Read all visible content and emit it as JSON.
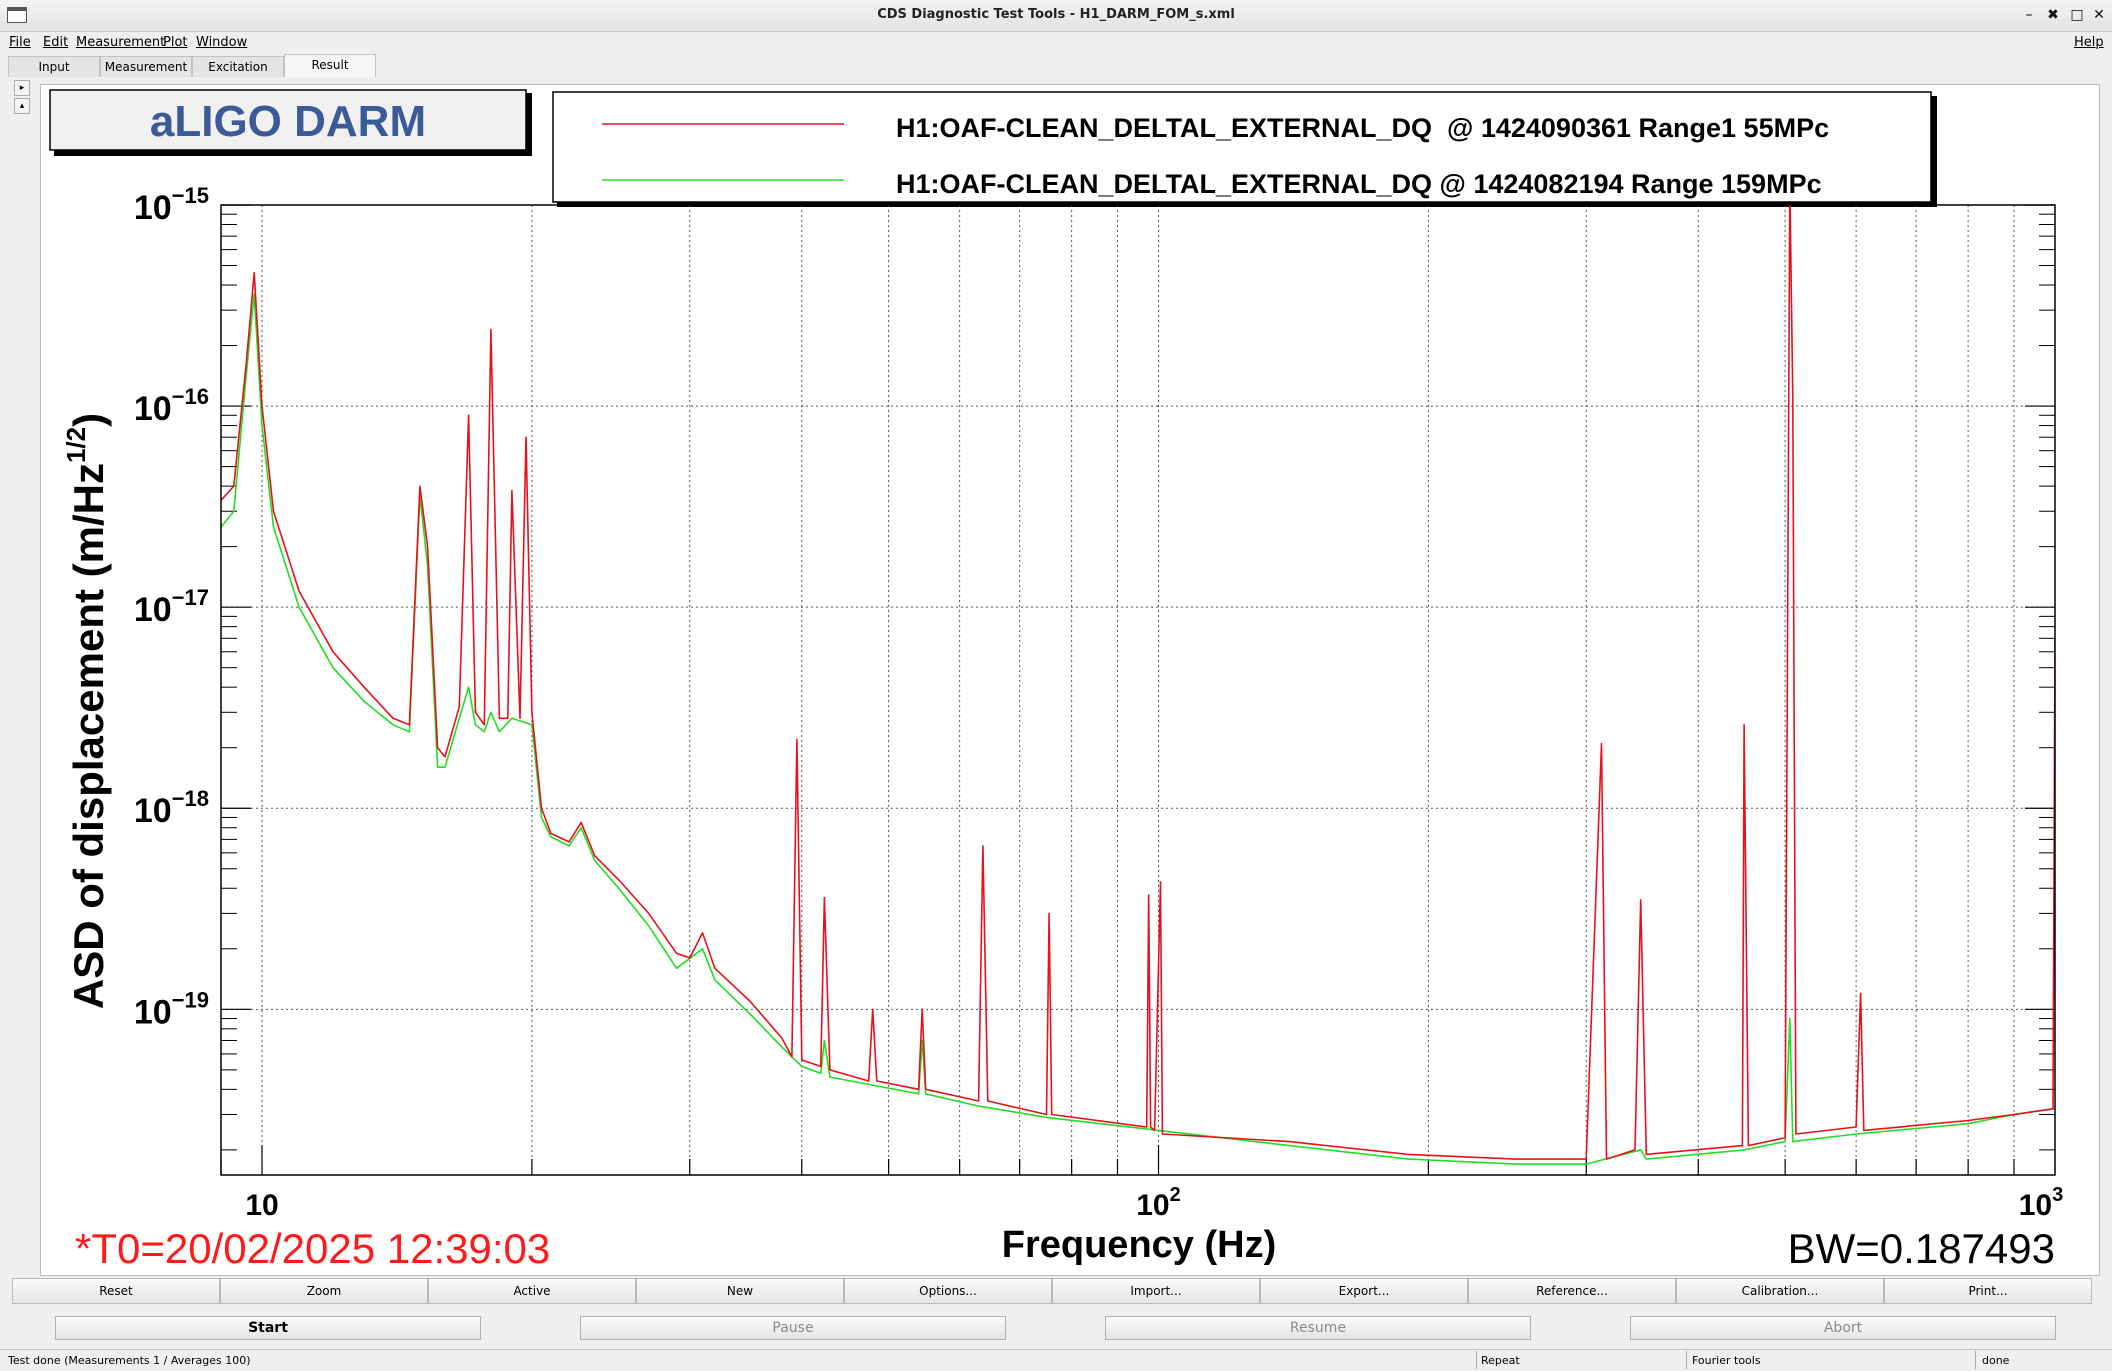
{
  "window": {
    "title": "CDS Diagnostic Test Tools - H1_DARM_FOM_s.xml",
    "controls": [
      "–",
      "✖",
      "□",
      "✕"
    ]
  },
  "menu": {
    "items": [
      "File",
      "Edit",
      "Measurement",
      "Plot",
      "Window"
    ],
    "help": "Help"
  },
  "tabs": [
    {
      "label": "Input"
    },
    {
      "label": "Measurement"
    },
    {
      "label": "Excitation"
    },
    {
      "label": "Result",
      "active": true
    }
  ],
  "plot": {
    "title_box": "aLIGO DARM",
    "t0_text": "*T0=20/02/2025 12:39:03",
    "bw_text": "BW=0.187493",
    "colors": {
      "red": "#e8101b",
      "green": "#22dd22",
      "title": "#3b5a98",
      "t0": "#ff1a1a"
    }
  },
  "chart_data": {
    "type": "line",
    "xlabel": "Frequency (Hz)",
    "ylabel": "ASD of displacement (m/Hz^{1/2})",
    "xscale": "log",
    "yscale": "log",
    "xlim": [
      9,
      1000
    ],
    "ylim": [
      1.5e-20,
      1e-15
    ],
    "grid": true,
    "legend_position": "top",
    "x_tick_labels": [
      {
        "value": 10,
        "base": "10",
        "exp": ""
      },
      {
        "value": 100,
        "base": "10",
        "exp": "2"
      },
      {
        "value": 1000,
        "base": "10",
        "exp": "3"
      }
    ],
    "y_tick_labels": [
      {
        "value": 1e-15,
        "base": "10",
        "exp": "−15"
      },
      {
        "value": 1e-16,
        "base": "10",
        "exp": "−16"
      },
      {
        "value": 1e-17,
        "base": "10",
        "exp": "−17"
      },
      {
        "value": 1e-18,
        "base": "10",
        "exp": "−18"
      },
      {
        "value": 1e-19,
        "base": "10",
        "exp": "−19"
      }
    ],
    "series": [
      {
        "name": "H1:OAF-CLEAN_DELTAL_EXTERNAL_DQ  @ 1424090361 Range1 55MPc",
        "color": "#e8101b",
        "points": [
          [
            9,
            3.4e-17
          ],
          [
            9.3,
            4e-17
          ],
          [
            9.6,
            1.6e-16
          ],
          [
            9.8,
            4.6e-16
          ],
          [
            10.0,
            1e-16
          ],
          [
            10.3,
            3e-17
          ],
          [
            11,
            1.2e-17
          ],
          [
            12,
            6e-18
          ],
          [
            13,
            4e-18
          ],
          [
            14,
            2.8e-18
          ],
          [
            14.6,
            2.6e-18
          ],
          [
            15,
            4e-17
          ],
          [
            15.3,
            2e-17
          ],
          [
            15.7,
            2e-18
          ],
          [
            16,
            1.8e-18
          ],
          [
            16.6,
            3.2e-18
          ],
          [
            17,
            9e-17
          ],
          [
            17.3,
            3e-18
          ],
          [
            17.7,
            2.6e-18
          ],
          [
            18,
            2.4e-16
          ],
          [
            18.4,
            2.8e-18
          ],
          [
            18.8,
            2.8e-18
          ],
          [
            19.0,
            3.8e-17
          ],
          [
            19.4,
            2.8e-18
          ],
          [
            19.7,
            7e-17
          ],
          [
            20,
            3e-18
          ],
          [
            20.5,
            1e-18
          ],
          [
            21,
            7.5e-19
          ],
          [
            22,
            6.8e-19
          ],
          [
            22.7,
            8.5e-19
          ],
          [
            23.5,
            5.8e-19
          ],
          [
            25,
            4.4e-19
          ],
          [
            27,
            3e-19
          ],
          [
            29,
            1.9e-19
          ],
          [
            30,
            1.8e-19
          ],
          [
            31,
            2.4e-19
          ],
          [
            32,
            1.6e-19
          ],
          [
            35,
            1.1e-19
          ],
          [
            38,
            7.2e-20
          ],
          [
            39,
            5.8e-20
          ],
          [
            39.5,
            2.2e-18
          ],
          [
            40,
            5.6e-20
          ],
          [
            42,
            5.2e-20
          ],
          [
            42.4,
            3.6e-19
          ],
          [
            43,
            5e-20
          ],
          [
            47.5,
            4.4e-20
          ],
          [
            48,
            1e-19
          ],
          [
            48.5,
            4.4e-20
          ],
          [
            54,
            4e-20
          ],
          [
            54.5,
            1e-19
          ],
          [
            55,
            4e-20
          ],
          [
            63,
            3.5e-20
          ],
          [
            63.7,
            6.5e-19
          ],
          [
            64.5,
            3.5e-20
          ],
          [
            75,
            3e-20
          ],
          [
            75.5,
            3e-19
          ],
          [
            76,
            3e-20
          ],
          [
            97,
            2.6e-20
          ],
          [
            97.5,
            3.7e-19
          ],
          [
            98,
            2.6e-20
          ],
          [
            99,
            2.5e-20
          ],
          [
            100.5,
            4.3e-19
          ],
          [
            101,
            2.4e-20
          ],
          [
            140,
            2.2e-20
          ],
          [
            190,
            1.9e-20
          ],
          [
            250,
            1.8e-20
          ],
          [
            300,
            1.8e-20
          ],
          [
            312,
            2.1e-18
          ],
          [
            316,
            1.8e-20
          ],
          [
            340,
            2e-20
          ],
          [
            345,
            3.5e-19
          ],
          [
            350,
            1.9e-20
          ],
          [
            448,
            2.1e-20
          ],
          [
            450,
            2.6e-18
          ],
          [
            455,
            2.1e-20
          ],
          [
            500,
            2.3e-20
          ],
          [
            506,
            1.3e-15
          ],
          [
            510,
            1.1e-16
          ],
          [
            514,
            2.4e-20
          ],
          [
            600,
            2.6e-20
          ],
          [
            607,
            1.2e-19
          ],
          [
            612,
            2.5e-20
          ],
          [
            800,
            2.8e-20
          ],
          [
            900,
            3e-20
          ],
          [
            995,
            3.2e-20
          ],
          [
            1000,
            7e-18
          ]
        ]
      },
      {
        "name": "H1:OAF-CLEAN_DELTAL_EXTERNAL_DQ @ 1424082194 Range 159MPc",
        "color": "#22dd22",
        "points": [
          [
            9,
            2.5e-17
          ],
          [
            9.3,
            3e-17
          ],
          [
            9.6,
            1.4e-16
          ],
          [
            9.8,
            3.6e-16
          ],
          [
            10.0,
            8e-17
          ],
          [
            10.3,
            2.5e-17
          ],
          [
            11,
            1e-17
          ],
          [
            12,
            5e-18
          ],
          [
            13,
            3.4e-18
          ],
          [
            14,
            2.6e-18
          ],
          [
            14.6,
            2.4e-18
          ],
          [
            15,
            3.6e-17
          ],
          [
            15.3,
            1.6e-17
          ],
          [
            15.7,
            1.6e-18
          ],
          [
            16,
            1.6e-18
          ],
          [
            16.6,
            2.8e-18
          ],
          [
            17,
            4e-18
          ],
          [
            17.3,
            2.6e-18
          ],
          [
            17.7,
            2.4e-18
          ],
          [
            18,
            3e-18
          ],
          [
            18.4,
            2.4e-18
          ],
          [
            19,
            2.8e-18
          ],
          [
            20,
            2.6e-18
          ],
          [
            20.5,
            9e-19
          ],
          [
            21,
            7.2e-19
          ],
          [
            22,
            6.5e-19
          ],
          [
            22.7,
            8e-19
          ],
          [
            23.5,
            5.5e-19
          ],
          [
            25,
            4e-19
          ],
          [
            27,
            2.6e-19
          ],
          [
            29,
            1.6e-19
          ],
          [
            31,
            2e-19
          ],
          [
            32,
            1.4e-19
          ],
          [
            35,
            9.5e-20
          ],
          [
            38,
            6.5e-20
          ],
          [
            40,
            5.2e-20
          ],
          [
            42,
            4.8e-20
          ],
          [
            42.4,
            7e-20
          ],
          [
            43,
            4.6e-20
          ],
          [
            48,
            4.2e-20
          ],
          [
            54,
            3.8e-20
          ],
          [
            54.5,
            7e-20
          ],
          [
            55,
            3.8e-20
          ],
          [
            63,
            3.3e-20
          ],
          [
            75,
            2.9e-20
          ],
          [
            100,
            2.5e-20
          ],
          [
            140,
            2.1e-20
          ],
          [
            190,
            1.8e-20
          ],
          [
            250,
            1.7e-20
          ],
          [
            300,
            1.7e-20
          ],
          [
            345,
            2e-20
          ],
          [
            350,
            1.8e-20
          ],
          [
            450,
            2e-20
          ],
          [
            500,
            2.2e-20
          ],
          [
            506,
            9e-20
          ],
          [
            510,
            2.2e-20
          ],
          [
            600,
            2.4e-20
          ],
          [
            800,
            2.7e-20
          ],
          [
            900,
            3e-20
          ],
          [
            1000,
            3.2e-20
          ]
        ]
      }
    ]
  },
  "buttons": {
    "plot_row": [
      "Reset",
      "Zoom",
      "Active",
      "New",
      "Options...",
      "Import...",
      "Export...",
      "Reference...",
      "Calibration...",
      "Print..."
    ],
    "control_row": [
      {
        "label": "Start",
        "enabled": true
      },
      {
        "label": "Pause",
        "enabled": false
      },
      {
        "label": "Resume",
        "enabled": false
      },
      {
        "label": "Abort",
        "enabled": false
      }
    ]
  },
  "status": {
    "message": "Test done (Measurements 1 / Averages 100)",
    "repeat": "Repeat",
    "tool": "Fourier tools",
    "state": "done"
  }
}
